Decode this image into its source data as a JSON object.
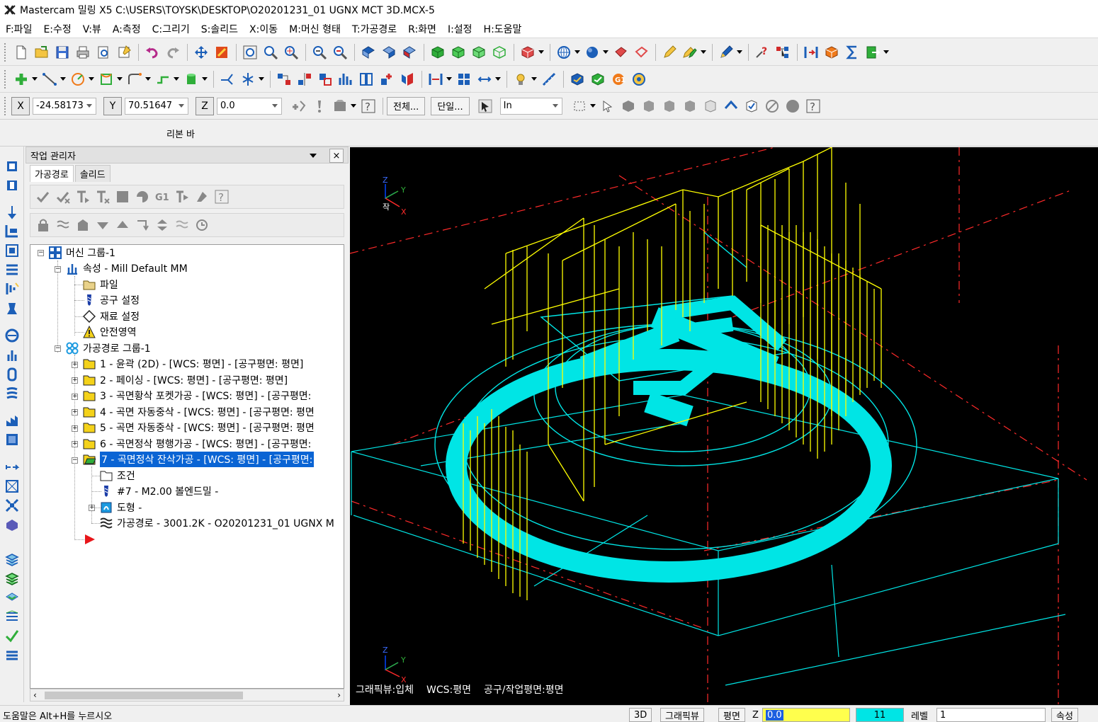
{
  "window": {
    "title": "Mastercam 밀링 X5  C:\\USERS\\TOYSK\\DESKTOP\\O20201231_01 UGNX MCT 3D.MCX-5"
  },
  "menu": [
    "F:파일",
    "E:수정",
    "V:뷰",
    "A:측정",
    "C:그리기",
    "S:솔리드",
    "X:이동",
    "M:머신 형태",
    "T:가공경로",
    "R:화면",
    "I:설정",
    "H:도움말"
  ],
  "coords": {
    "x_label": "X",
    "x_value": "-24.58173",
    "y_label": "Y",
    "y_value": "70.51647",
    "z_label": "Z",
    "z_value": "0.0",
    "all_button": "전체...",
    "single_button": "단일...",
    "units_value": "In"
  },
  "ribbon": {
    "label": "리본 바"
  },
  "opmanager": {
    "title": "작업 관리자",
    "close": "×",
    "tabs": [
      "가공경로",
      "솔리드"
    ],
    "tree": {
      "machine_group": "머신 그룹-1",
      "properties": "속성 - Mill Default MM",
      "file": "파일",
      "tool_settings": "공구 설정",
      "stock_settings": "재료 설정",
      "safety_zone": "안전영역",
      "toolpath_group": "가공경로 그룹-1",
      "ops": [
        "1 - 윤곽 (2D) - [WCS: 평면] - [공구평면: 평면]",
        "2 - 페이싱 - [WCS: 평면] - [공구평면: 평면]",
        "3 - 곡면황삭 포켓가공 - [WCS: 평면] - [공구평면:",
        "4 - 곡면 자동중삭 - [WCS: 평면] - [공구평면: 평면",
        "5 - 곡면 자동중삭 - [WCS: 평면] - [공구평면: 평면",
        "6 - 곡면정삭 평행가공 - [WCS: 평면] - [공구평면:",
        "7 - 곡면정삭 잔삭가공 - [WCS: 평면] - [공구평면:"
      ],
      "parameters": "조건",
      "tool": "#7 - M2.00 볼엔드밀 -",
      "geometry": "도형 -",
      "toolpath": "가공경로 - 3001.2K - O20201231_01 UGNX M"
    }
  },
  "viewport": {
    "axis_z": "Z",
    "axis_y": "Y",
    "axis_x": "X",
    "wcs_mark": "작",
    "gview": "그래픽뷰:입체",
    "wcs": "WCS:평면",
    "tplane": "공구/작업평면:평면",
    "colors": {
      "background": "#000000",
      "cyan": "#00e5e5",
      "yellow": "#ffff00",
      "red": "#ff2a2a"
    }
  },
  "statusbar": {
    "help": "도움말은 Alt+H를 누르시오",
    "btn_3d": "3D",
    "gview": "그래픽뷰",
    "plane": "평면",
    "z_label": "Z",
    "z_value": "0.0",
    "color_value": "11",
    "level_label": "레벨",
    "level_value": "1",
    "attributes": "속성"
  }
}
